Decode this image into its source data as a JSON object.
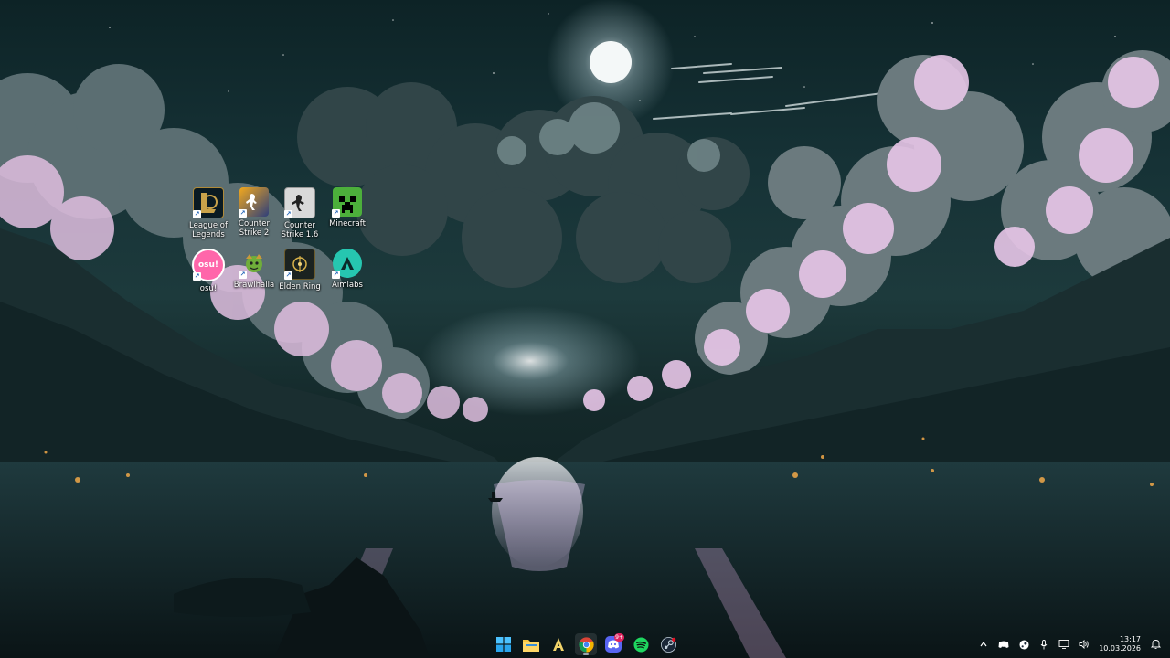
{
  "desktop": {
    "icons": [
      {
        "label": "League of\nLegends",
        "icon": "league-of-legends-icon"
      },
      {
        "label": "Counter\nStrike 2",
        "icon": "counter-strike-2-icon"
      },
      {
        "label": "Counter\nStrike 1.6",
        "icon": "counter-strike-16-icon"
      },
      {
        "label": "Minecraft",
        "icon": "minecraft-icon"
      },
      {
        "label": "osu!",
        "icon": "osu-icon",
        "glyph": "osu!"
      },
      {
        "label": "Brawlhalla",
        "icon": "brawlhalla-icon"
      },
      {
        "label": "Elden Ring",
        "icon": "elden-ring-icon"
      },
      {
        "label": "Aimlabs",
        "icon": "aimlabs-icon"
      }
    ]
  },
  "taskbar": {
    "apps": [
      {
        "name": "Start",
        "icon": "windows-start-icon"
      },
      {
        "name": "File Explorer",
        "icon": "folder-icon"
      },
      {
        "name": "Arc / A app",
        "icon": "a-app-icon"
      },
      {
        "name": "Google Chrome",
        "icon": "chrome-icon"
      },
      {
        "name": "Discord",
        "icon": "discord-icon",
        "badge": "9+"
      },
      {
        "name": "Spotify",
        "icon": "spotify-icon"
      },
      {
        "name": "Steam-like",
        "icon": "steam-app-icon"
      }
    ],
    "tray": {
      "icons": [
        "chevron-up-icon",
        "discord-tray-icon",
        "steam-tray-icon",
        "microphone-icon",
        "network-icon",
        "volume-icon"
      ],
      "time": "13:17",
      "date": "10.03.2026",
      "notification_icon": "notification-bell-icon"
    }
  },
  "colors": {
    "sky": "#163236",
    "cloud_pink": "#e3bfe0",
    "moon": "#ffffff",
    "water": "#0f2124"
  }
}
